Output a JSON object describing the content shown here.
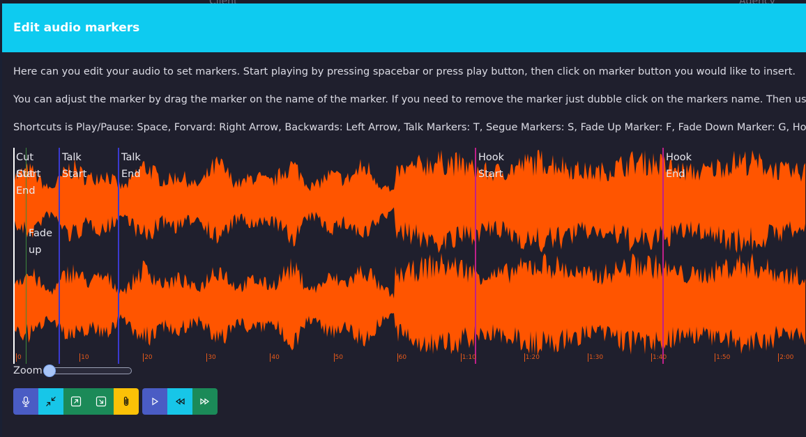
{
  "background": {
    "client_label": "Client",
    "agency_label": "Agency"
  },
  "modal": {
    "title": "Edit audio markers",
    "paragraphs": [
      "Here can you edit your audio to set markers. Start playing by pressing spacebar or press play button, then click on marker button you would like to insert.",
      "You can adjust the marker by drag the marker on the name of the marker. If you need to remove the marker just dubble click on the markers name. Then use the",
      "Shortcuts is Play/Pause: Space, Forvard: Right Arrow, Backwards: Left Arrow, Talk Markers: T, Segue Markers: S, Fade Up Marker: F, Fade Down Marker: G, Hook"
    ]
  },
  "waveform": {
    "wave_color": "#ff5500",
    "progress_color": "#ffffff",
    "markers": [
      {
        "label": "Cut\nStart",
        "color": "#ffffff"
      },
      {
        "label": "Cut\nEnd",
        "color": "#ffffff"
      },
      {
        "label": "Fade\nup",
        "color": "#3d8a3d"
      },
      {
        "label": "Talk\nStart",
        "color": "#3a3ad0"
      },
      {
        "label": "Talk\nEnd",
        "color": "#3a3ad0"
      },
      {
        "label": "Hook\nStart",
        "color": "#c0208a"
      },
      {
        "label": "Hook\nEnd",
        "color": "#c0208a"
      }
    ]
  },
  "timeline": {
    "labels": [
      "0",
      "10",
      "20",
      "30",
      "40",
      "50",
      "60",
      "1:10",
      "1:20",
      "1:30",
      "1:40",
      "1:50",
      "2:00"
    ]
  },
  "zoom": {
    "label": "Zoom",
    "value": 0
  },
  "toolbar": {
    "group1": [
      {
        "icon": "microphone-icon",
        "color": "#4a5cc4"
      },
      {
        "icon": "collapse-arrows-icon",
        "color": "#17c6e8"
      },
      {
        "icon": "arrow-up-right-box-icon",
        "color": "#1b8a58"
      },
      {
        "icon": "arrow-down-right-box-icon",
        "color": "#1b8a58"
      },
      {
        "icon": "paperclip-icon",
        "color": "#fbc107"
      }
    ],
    "group2": [
      {
        "icon": "play-icon",
        "color": "#4a5cc4"
      },
      {
        "icon": "rewind-icon",
        "color": "#17c6e8"
      },
      {
        "icon": "fast-forward-icon",
        "color": "#1b8a58"
      }
    ]
  }
}
